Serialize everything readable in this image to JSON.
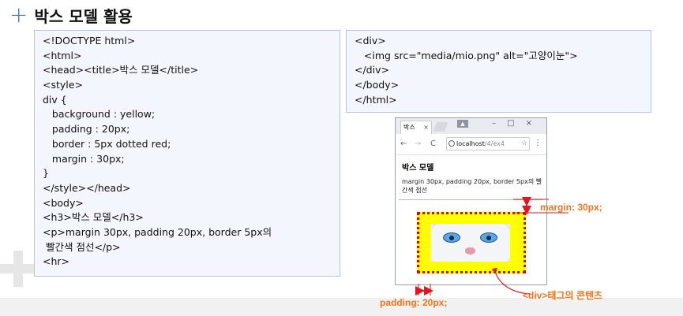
{
  "slide": {
    "title": "박스 모델 활용",
    "title_icon": "plus-icon"
  },
  "code_left": {
    "lines": [
      "<!DOCTYPE html>",
      "<html>",
      "<head><title>박스 모델</title>",
      "<style>",
      "div {",
      "   background : yellow;",
      "   padding : 20px;",
      "   border : 5px dotted red;",
      "   margin : 30px;",
      "}",
      "</style></head>",
      "<body>",
      "<h3>박스 모델</h3>",
      "<p>margin 30px, padding 20px, border 5px의",
      " 빨간색 점선</p>",
      "<hr>"
    ]
  },
  "code_right": {
    "lines": [
      "<div>",
      "   <img src=\"media/mio.png\" alt=\"고양이눈\">",
      "</div>",
      "</body>",
      "</html>"
    ]
  },
  "browser": {
    "tab_title": "박스",
    "tab_close": "×",
    "window_controls": "–□×",
    "nav_back": "←",
    "nav_forward": "→",
    "nav_reload": "C",
    "url_host": "localhost",
    "url_path": "/4/ex4",
    "star": "☆",
    "menu": "⋮",
    "page_heading": "박스 모델",
    "page_paragraph": "margin 30px, padding 20px, border 5px의 빨간색 점선"
  },
  "annotations": {
    "margin": "margin: 30px;",
    "padding": "padding: 20px;",
    "content": "<div>태그의 콘텐츠"
  },
  "colors": {
    "accent": "#3b79c7",
    "annotation": "#f0751f",
    "arrow": "#e8141c",
    "div_background": "#ffff00",
    "div_border": "#e00000"
  }
}
